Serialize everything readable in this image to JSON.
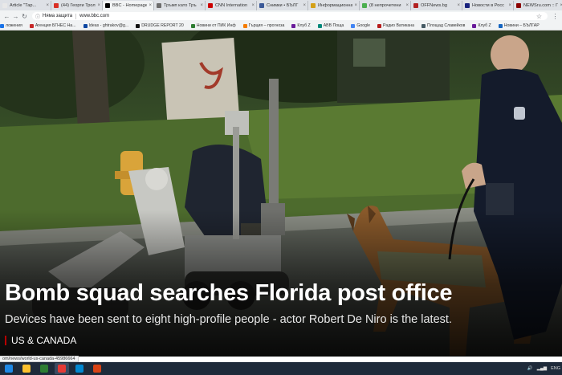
{
  "browser": {
    "tabs": [
      {
        "title": "Article \"Тар...",
        "color": "#e8e8e8",
        "active": false
      },
      {
        "title": "(44) Георги Трол",
        "color": "#d93025",
        "active": false
      },
      {
        "title": "BBC - Homepage",
        "color": "#000000",
        "active": true
      },
      {
        "title": "Тръмп като Тръ",
        "color": "#6d6d6d",
        "active": false
      },
      {
        "title": "CNN Internation",
        "color": "#cc0000",
        "active": false
      },
      {
        "title": "Снимки • БЪЛГ",
        "color": "#3b5998",
        "active": false
      },
      {
        "title": "Информационна",
        "color": "#d4a017",
        "active": false
      },
      {
        "title": "(8 непрочетени",
        "color": "#4caf50",
        "active": false
      },
      {
        "title": "OFFNews.bg",
        "color": "#b22222",
        "active": false
      },
      {
        "title": "Новости в Росс",
        "color": "#1a237e",
        "active": false
      },
      {
        "title": "NEWSru.com :: Г",
        "color": "#8b0000",
        "active": false
      }
    ],
    "new_tab_label": "+",
    "close_glyph": "×",
    "address": {
      "security_label": "Няма защита",
      "url": "www.bbc.com"
    },
    "bookmarks": [
      {
        "label": "ложения",
        "color": "#1a73e8"
      },
      {
        "label": "Агенция БГНЕС На...",
        "color": "#c62828"
      },
      {
        "label": "Ideas - ghtrakov@g...",
        "color": "#0d47a1"
      },
      {
        "label": "DRUDGE REPORT 20",
        "color": "#111111"
      },
      {
        "label": "Новини от ПИК Инф",
        "color": "#2e7d32"
      },
      {
        "label": "Гърция – прогноза",
        "color": "#f57c00"
      },
      {
        "label": "Клуб Z",
        "color": "#6a1b9a"
      },
      {
        "label": "АВВ Поща",
        "color": "#00897b"
      },
      {
        "label": "Google",
        "color": "#4285f4"
      },
      {
        "label": "Радио Ватикана",
        "color": "#b71c1c"
      },
      {
        "label": "Площад Славейков",
        "color": "#455a64"
      },
      {
        "label": "Клуб Z",
        "color": "#6a1b9a"
      },
      {
        "label": "Новини – БЪЛГАР",
        "color": "#1565c0"
      }
    ]
  },
  "article": {
    "headline": "Bomb squad searches Florida post office",
    "summary": "Devices have been sent to eight high-profile people - actor Robert De Niro is the latest.",
    "section": "US & CANADA"
  },
  "status_url": "om/news/world-us-canada-45986664",
  "taskbar": {
    "apps": [
      {
        "name": "start",
        "color": "#1e88e5",
        "active": false
      },
      {
        "name": "file-explorer",
        "color": "#fbc02d",
        "active": false
      },
      {
        "name": "excel",
        "color": "#2e7d32",
        "active": false
      },
      {
        "name": "chrome",
        "color": "#e53935",
        "active": true
      },
      {
        "name": "skype",
        "color": "#0288d1",
        "active": false
      },
      {
        "name": "media",
        "color": "#d84315",
        "active": false
      }
    ],
    "lang": "ENG"
  },
  "colors": {
    "accent_red": "#b80000",
    "headline": "#ffffff"
  }
}
